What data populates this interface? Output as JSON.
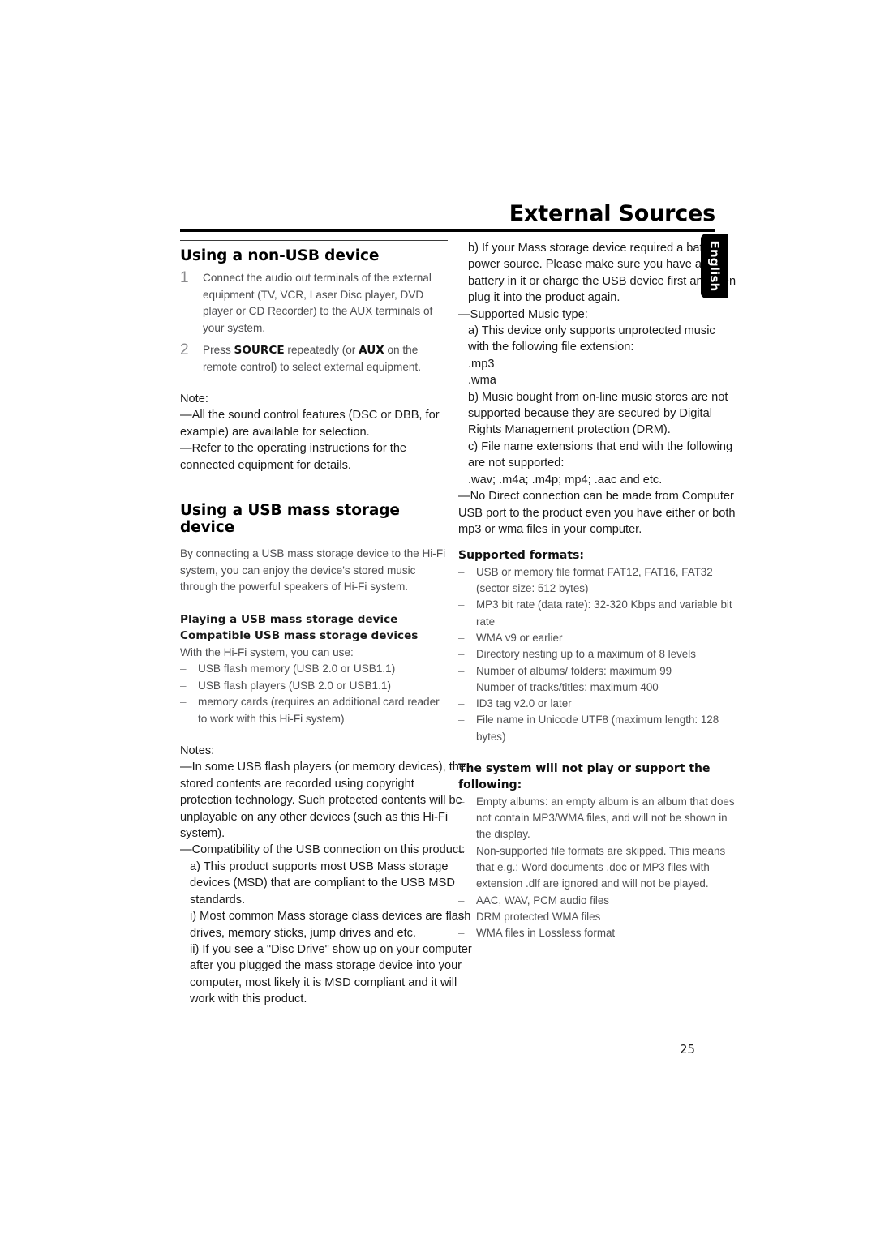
{
  "document": {
    "title": "External Sources",
    "page_number": "25",
    "language_tab": "English"
  },
  "left_column": {
    "section1": {
      "heading": "Using a non-USB device",
      "steps": [
        {
          "number": "1",
          "text": "Connect the audio out terminals of the external equipment (TV, VCR, Laser Disc player, DVD player or CD Recorder) to the AUX terminals of your system."
        },
        {
          "number": "2",
          "text_before": "Press ",
          "bold1": "SOURCE",
          "text_mid": " repeatedly (or ",
          "bold2": "AUX",
          "text_after": " on the remote control) to select external equipment."
        }
      ],
      "note_label": "Note:",
      "notes": [
        "—All the sound control features (DSC or DBB, for example) are available for selection.",
        "—Refer to the operating instructions for the connected equipment for details."
      ]
    },
    "section2": {
      "heading": "Using a USB mass storage device",
      "intro": "By connecting a USB mass storage device to the Hi-Fi system, you can enjoy the device's stored music through the powerful speakers of Hi-Fi system.",
      "subheading1": "Playing a USB mass storage device",
      "subheading2": "Compatible USB mass storage devices",
      "list_intro": "With the Hi-Fi system, you can use:",
      "dash_items": [
        "USB flash memory (USB 2.0 or USB1.1)",
        "USB flash players (USB 2.0 or USB1.1)",
        "memory cards (requires an additional card reader to work with this Hi-Fi system)"
      ],
      "notes_label": "Notes:",
      "note1": "—In some USB flash players (or memory devices), the stored contents are recorded using copyright protection technology. Such protected contents will be unplayable on any other devices (such as this Hi-Fi system).",
      "note2": "—Compatibility of the USB connection on this product:",
      "item_a": "a) This product supports most USB Mass storage devices (MSD) that are compliant to the USB MSD standards.",
      "item_i": "i) Most common Mass storage class devices are flash drives, memory sticks, jump drives and etc.",
      "item_ii": "ii) If you see a \"Disc Drive\" show up on your computer after you plugged the mass storage device into your computer, most likely it is MSD compliant and it will work with this product."
    }
  },
  "right_column": {
    "item_b": "b) If your Mass storage device required a battery power source. Please make sure you have a battery in it or charge the USB device first and then plug it into the product again.",
    "supported_music_label": "—Supported Music type:",
    "music_a": "a) This device only supports unprotected music with the following file extension:",
    "ext_mp3": ".mp3",
    "ext_wma": ".wma",
    "music_b": "b) Music bought from on-line music stores are not supported because they are secured by Digital Rights Management protection (DRM).",
    "music_c": "c) File name extensions that end with the following are not supported:",
    "unsupported_ext": ".wav; .m4a; .m4p; mp4; .aac and etc.",
    "no_direct": "—No Direct connection can be made from Computer USB port to the product even you have either or both mp3 or wma files in your computer.",
    "supported_formats_heading": "Supported formats:",
    "supported_formats": [
      "USB or memory file format FAT12, FAT16, FAT32 (sector size: 512 bytes)",
      "MP3 bit rate (data rate): 32-320 Kbps and variable bit rate",
      "WMA v9 or earlier",
      "Directory nesting up to a maximum of 8 levels",
      "Number of albums/ folders: maximum 99",
      "Number of tracks/titles: maximum 400",
      "ID3 tag v2.0 or later",
      "File name in Unicode UTF8 (maximum length: 128 bytes)"
    ],
    "not_supported_heading": "The system will not play or support the following:",
    "not_supported": [
      "Empty albums: an empty album is an album that does not contain MP3/WMA files, and will not be shown in the display.",
      "Non-supported file formats are skipped. This means that e.g.: Word documents .doc or MP3 files with extension .dlf are ignored and will not be played.",
      "AAC, WAV, PCM audio files",
      "DRM protected WMA files",
      "WMA files in Lossless format"
    ]
  },
  "symbols": {
    "dash": "–"
  }
}
